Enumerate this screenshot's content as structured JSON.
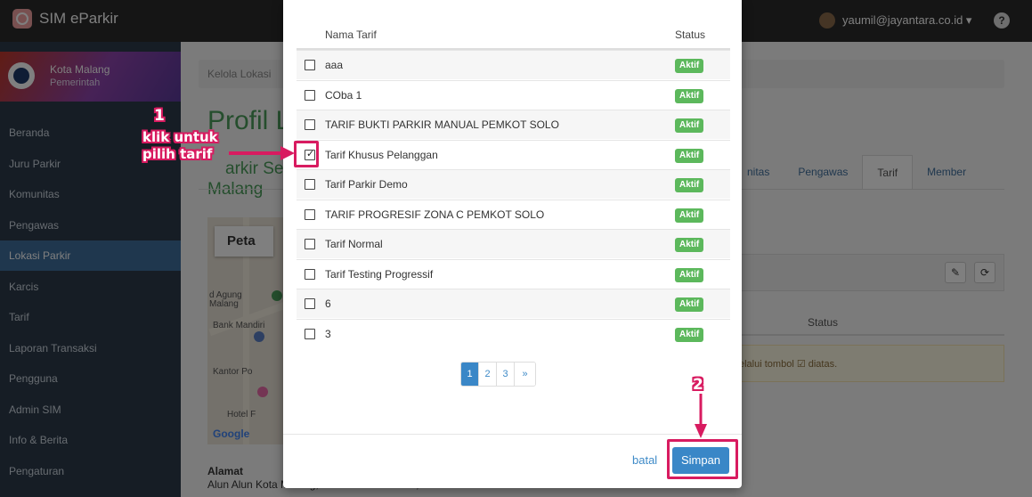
{
  "app": {
    "brand": "SIM eParkir",
    "user_email": "yaumil@jayantara.co.id ▾"
  },
  "sidebar": {
    "profile_name": "Kota Malang",
    "profile_role": "Pemerintah",
    "items": [
      {
        "label": "Beranda"
      },
      {
        "label": "Juru Parkir"
      },
      {
        "label": "Komunitas"
      },
      {
        "label": "Pengawas"
      },
      {
        "label": "Lokasi Parkir",
        "active": true
      },
      {
        "label": "Karcis"
      },
      {
        "label": "Tarif"
      },
      {
        "label": "Laporan Transaksi"
      },
      {
        "label": "Pengguna"
      },
      {
        "label": "Admin SIM"
      },
      {
        "label": "Info & Berita"
      },
      {
        "label": "Pengaturan"
      }
    ]
  },
  "main": {
    "breadcrumb": "Kelola Lokasi",
    "title": "Profil L",
    "subtitle_line1": "arkir Se",
    "subtitle_line2": "Malang",
    "tabs": [
      {
        "label": "nitas"
      },
      {
        "label": "Pengawas"
      },
      {
        "label": "Tarif",
        "active": true
      },
      {
        "label": "Member"
      }
    ],
    "map": {
      "tab_label": "Peta",
      "labels": [
        "d Agung",
        "Malang",
        "Bank Mandiri",
        "Kantor Po",
        "Hotel F"
      ],
      "google": "Google"
    },
    "status_header": "Status",
    "info_text": "elalui tombol ☑ diatas.",
    "alamat_label": "Alamat",
    "alamat_value": "Alun Alun Kota Malang, Jl. Merdeka Selatan,"
  },
  "modal": {
    "col_name": "Nama Tarif",
    "col_status": "Status",
    "rows": [
      {
        "name": "aaa",
        "status": "Aktif",
        "checked": false
      },
      {
        "name": "COba 1",
        "status": "Aktif",
        "checked": false
      },
      {
        "name": "TARIF BUKTI PARKIR MANUAL PEMKOT SOLO",
        "status": "Aktif",
        "checked": false
      },
      {
        "name": "Tarif Khusus Pelanggan",
        "status": "Aktif",
        "checked": true
      },
      {
        "name": "Tarif Parkir Demo",
        "status": "Aktif",
        "checked": false
      },
      {
        "name": "TARIF PROGRESIF ZONA C PEMKOT SOLO",
        "status": "Aktif",
        "checked": false
      },
      {
        "name": "Tarif Normal",
        "status": "Aktif",
        "checked": false
      },
      {
        "name": "Tarif Testing Progressif",
        "status": "Aktif",
        "checked": false
      },
      {
        "name": "6",
        "status": "Aktif",
        "checked": false
      },
      {
        "name": "3",
        "status": "Aktif",
        "checked": false
      }
    ],
    "pagination": [
      "1",
      "2",
      "3",
      "»"
    ],
    "active_page": "1",
    "cancel_label": "batal",
    "save_label": "Simpan"
  },
  "annotations": {
    "step1_number": "1",
    "step1_line1": "klik untuk",
    "step1_line2": "pilih tarif",
    "step2_number": "2",
    "color": "#d81b60"
  }
}
